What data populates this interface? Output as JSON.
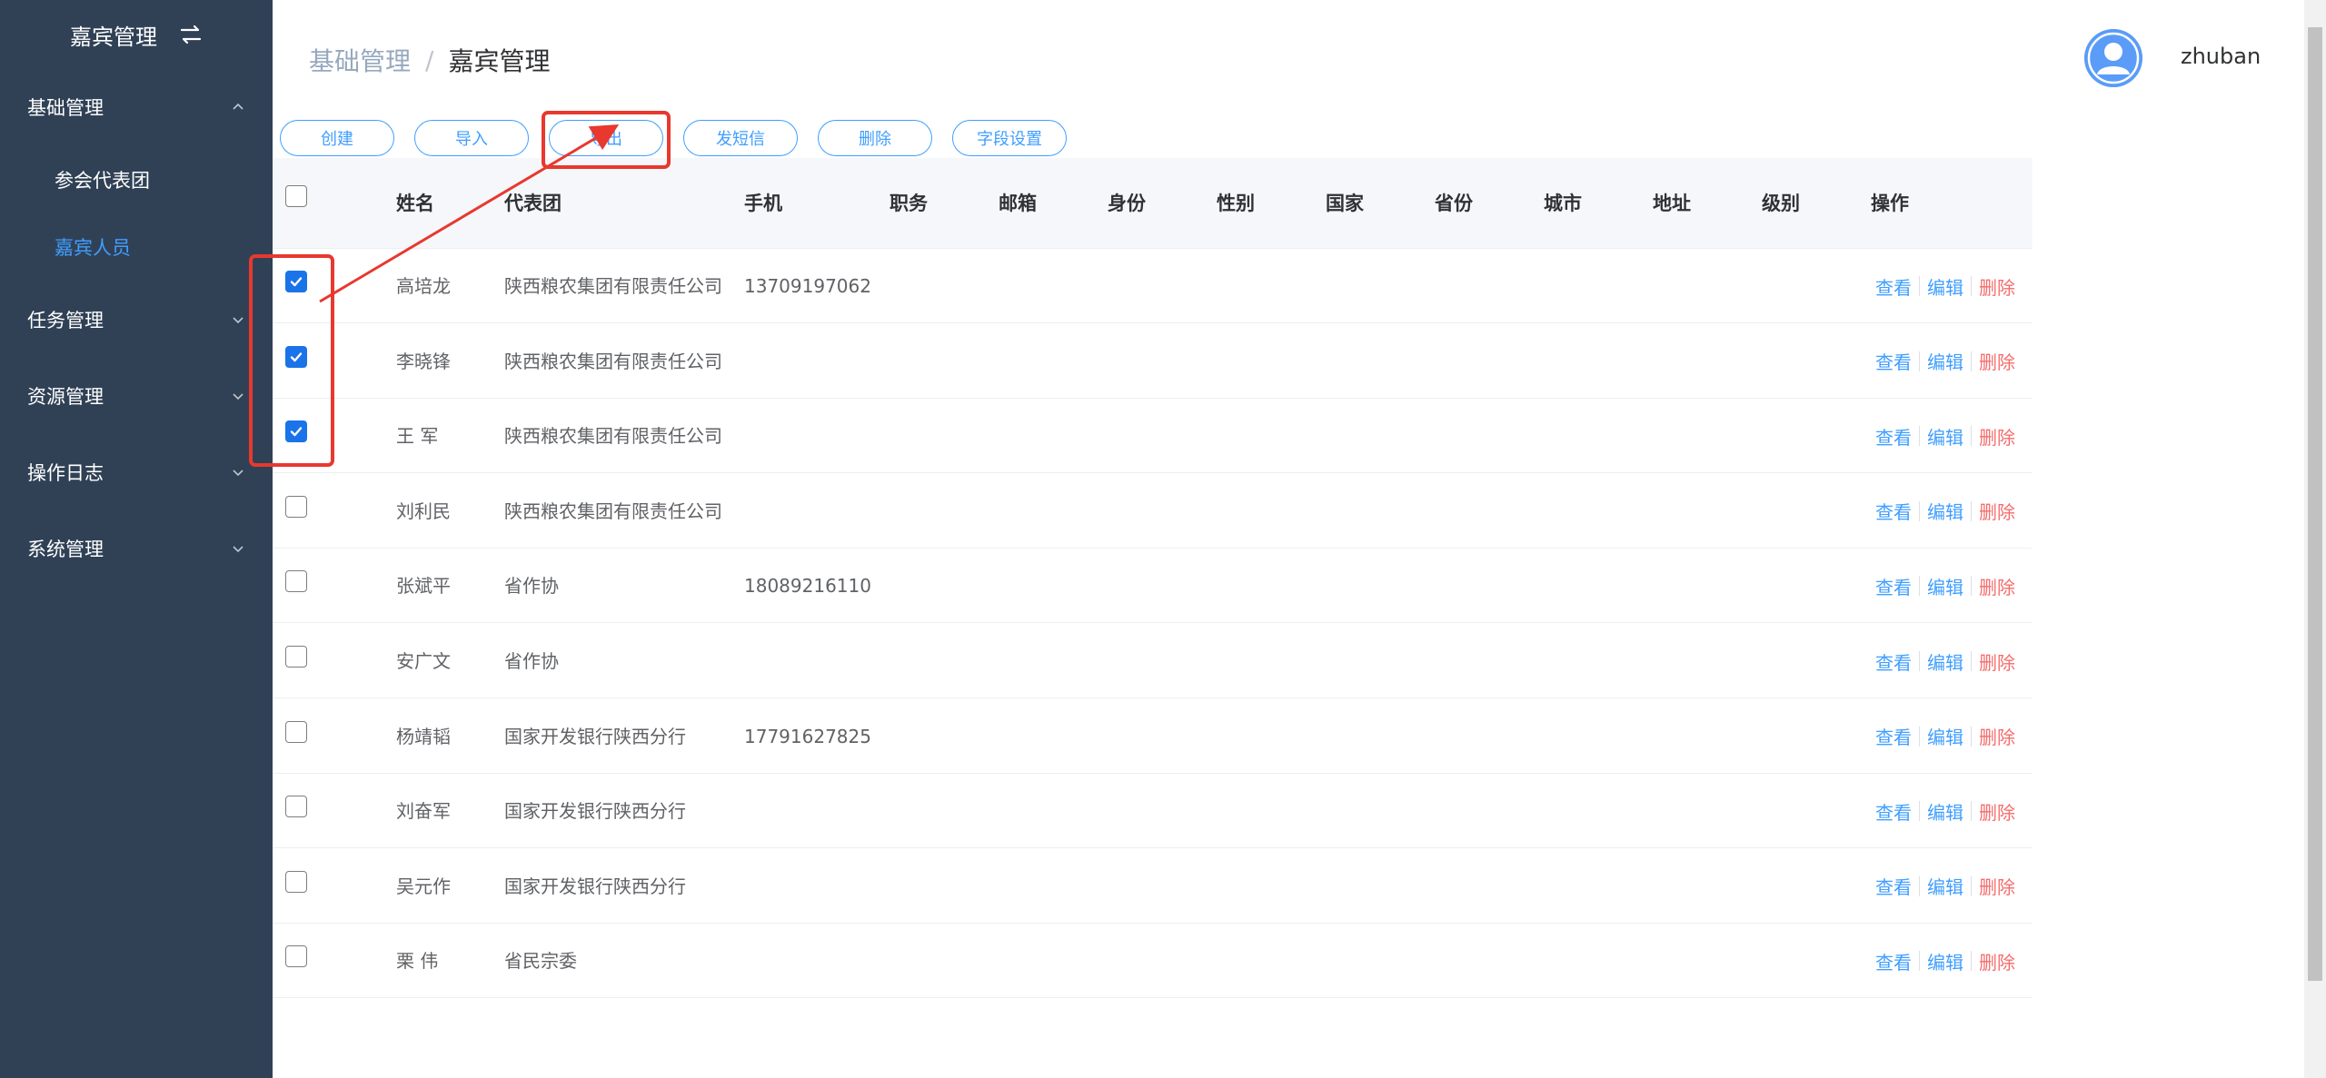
{
  "sidebar": {
    "title": "嘉宾管理",
    "menu": [
      {
        "label": "基础管理",
        "expanded": true,
        "children": [
          {
            "label": "参会代表团",
            "active": false
          },
          {
            "label": "嘉宾人员",
            "active": true
          }
        ]
      },
      {
        "label": "任务管理",
        "expanded": false
      },
      {
        "label": "资源管理",
        "expanded": false
      },
      {
        "label": "操作日志",
        "expanded": false
      },
      {
        "label": "系统管理",
        "expanded": false
      }
    ]
  },
  "header": {
    "breadcrumb": [
      "基础管理",
      "嘉宾管理"
    ],
    "breadcrumb_separator": "/",
    "username": "zhuban"
  },
  "toolbar": {
    "create": "创建",
    "import": "导入",
    "export": "导出",
    "sms": "发短信",
    "delete": "删除",
    "field_settings": "字段设置"
  },
  "table": {
    "columns": [
      "姓名",
      "代表团",
      "手机",
      "职务",
      "邮箱",
      "身份",
      "性别",
      "国家",
      "省份",
      "城市",
      "地址",
      "级别",
      "操作"
    ],
    "rows": [
      {
        "checked": true,
        "name": "高培龙",
        "delegation": "陕西粮农集团有限责任公司",
        "phone": "13709197062"
      },
      {
        "checked": true,
        "name": "李晓锋",
        "delegation": "陕西粮农集团有限责任公司",
        "phone": ""
      },
      {
        "checked": true,
        "name": "王 军",
        "delegation": "陕西粮农集团有限责任公司",
        "phone": ""
      },
      {
        "checked": false,
        "name": "刘利民",
        "delegation": "陕西粮农集团有限责任公司",
        "phone": ""
      },
      {
        "checked": false,
        "name": "张斌平",
        "delegation": "省作协",
        "phone": "18089216110"
      },
      {
        "checked": false,
        "name": "安广文",
        "delegation": "省作协",
        "phone": ""
      },
      {
        "checked": false,
        "name": "杨靖韬",
        "delegation": "国家开发银行陕西分行",
        "phone": "17791627825"
      },
      {
        "checked": false,
        "name": "刘奋军",
        "delegation": "国家开发银行陕西分行",
        "phone": ""
      },
      {
        "checked": false,
        "name": "吴元作",
        "delegation": "国家开发银行陕西分行",
        "phone": ""
      },
      {
        "checked": false,
        "name": "栗 伟",
        "delegation": "省民宗委",
        "phone": ""
      }
    ],
    "actions": {
      "view": "查看",
      "edit": "编辑",
      "delete": "删除"
    }
  },
  "colors": {
    "sidebar_bg": "#304156",
    "accent": "#409eff",
    "danger": "#f56c6c",
    "annotation": "#e8382f"
  },
  "icons": {
    "brand": "swap-arrows-icon",
    "menu_expanded": "chevron-up-icon",
    "menu_collapsed": "chevron-down-icon",
    "avatar": "user-avatar-icon"
  }
}
